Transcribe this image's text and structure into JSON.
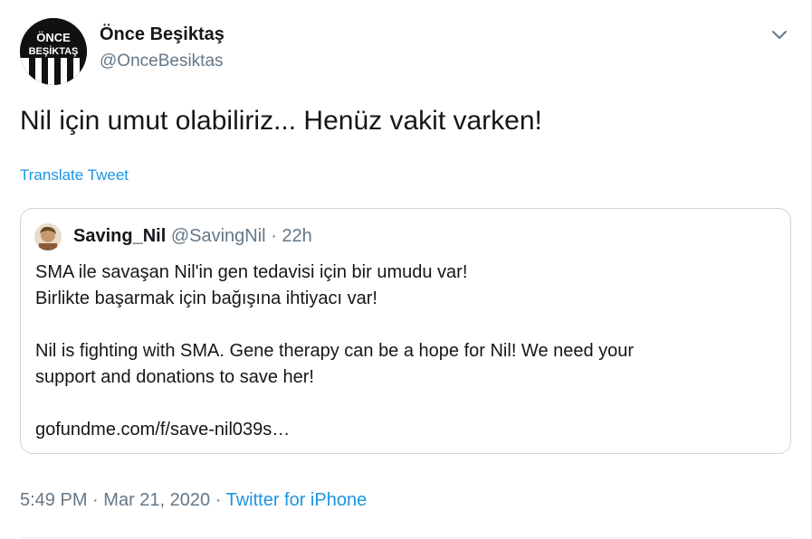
{
  "author": {
    "display_name": "Önce Beşiktaş",
    "handle": "@OnceBesiktas",
    "avatar_text_line1": "ÖNCE",
    "avatar_text_line2": "BEŞİKTAŞ"
  },
  "tweet": {
    "text": "Nil için umut olabiliriz... Henüz vakit varken!",
    "translate_label": "Translate Tweet"
  },
  "quoted_tweet": {
    "display_name": "Saving_Nil",
    "handle": "@SavingNil",
    "separator": "·",
    "time": "22h",
    "lines": [
      "SMA ile savaşan Nil'in gen tedavisi için bir umudu var!",
      "Birlikte başarmak için bağışına ihtiyacı var!",
      "Nil is fighting with SMA. Gene therapy can be a hope for Nil! We need your",
      "support and donations to save her!",
      "gofundme.com/f/save-nil039s…"
    ]
  },
  "meta": {
    "time": "5:49 PM",
    "separator1": "·",
    "date": "Mar 21, 2020",
    "separator2": "·",
    "source": "Twitter for iPhone"
  },
  "icons": {
    "menu": "chevron-down-icon"
  },
  "colors": {
    "link": "#1b95e0",
    "secondary": "#657786",
    "border": "#ccd6dd"
  }
}
